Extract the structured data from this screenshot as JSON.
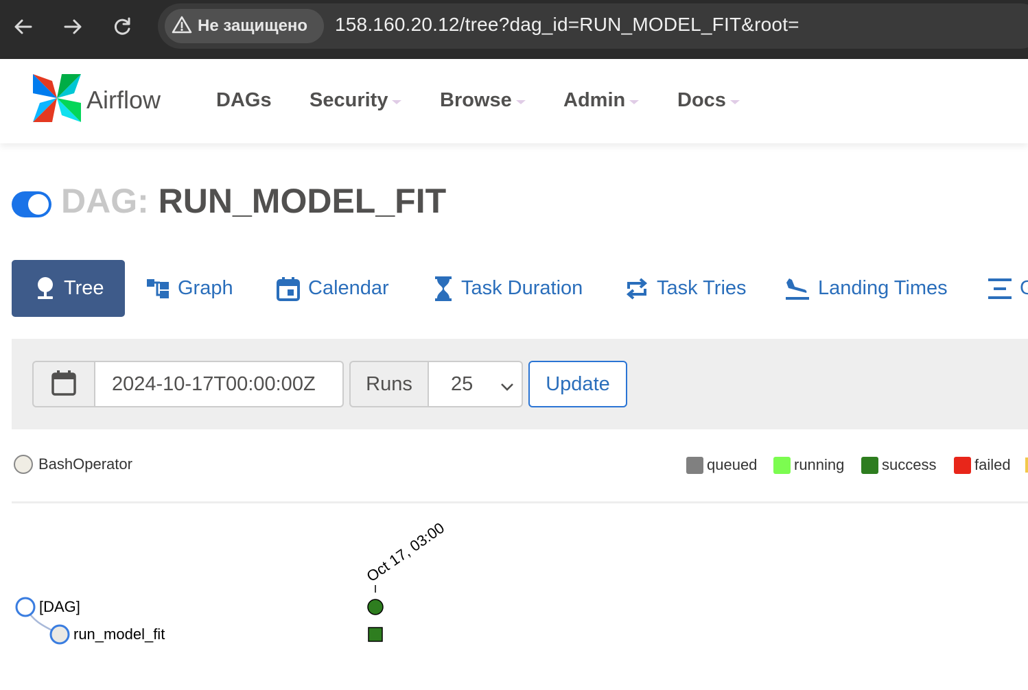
{
  "browser": {
    "security_label": "Не защищено",
    "url": "158.160.20.12/tree?dag_id=RUN_MODEL_FIT&root="
  },
  "navbar": {
    "brand": "Airflow",
    "items": [
      {
        "label": "DAGs",
        "dropdown": false
      },
      {
        "label": "Security",
        "dropdown": true
      },
      {
        "label": "Browse",
        "dropdown": true
      },
      {
        "label": "Admin",
        "dropdown": true
      },
      {
        "label": "Docs",
        "dropdown": true
      }
    ]
  },
  "page": {
    "dag_prefix": "DAG:",
    "dag_id": "RUN_MODEL_FIT",
    "paused": false
  },
  "tabs": [
    {
      "label": "Tree",
      "icon": "tree-icon",
      "active": true
    },
    {
      "label": "Graph",
      "icon": "graph-icon",
      "active": false
    },
    {
      "label": "Calendar",
      "icon": "calendar-icon",
      "active": false
    },
    {
      "label": "Task Duration",
      "icon": "hourglass-icon",
      "active": false
    },
    {
      "label": "Task Tries",
      "icon": "retweet-icon",
      "active": false
    },
    {
      "label": "Landing Times",
      "icon": "plane-landing-icon",
      "active": false
    },
    {
      "label": "G",
      "icon": "gantt-icon",
      "active": false
    }
  ],
  "filter": {
    "base_date": "2024-10-17T00:00:00Z",
    "runs_label": "Runs",
    "runs_value": "25",
    "update_label": "Update"
  },
  "legend": {
    "operators": [
      {
        "label": "BashOperator",
        "color": "#f0ede4"
      }
    ],
    "states": [
      {
        "label": "queued",
        "color": "#808080"
      },
      {
        "label": "running",
        "color": "#7cfc50"
      },
      {
        "label": "success",
        "color": "#2e7d1f"
      },
      {
        "label": "failed",
        "color": "#e8261a"
      }
    ]
  },
  "tree": {
    "runs": [
      {
        "label": "Oct 17, 03:00",
        "state": "success"
      }
    ],
    "nodes": [
      {
        "label": "[DAG]",
        "state": "success"
      },
      {
        "label": "run_model_fit",
        "state": "success"
      }
    ]
  },
  "colors": {
    "accent": "#1a73e8",
    "active_tab": "#3e5b8a",
    "link": "#2a6ebb",
    "success": "#2e7d1f"
  }
}
